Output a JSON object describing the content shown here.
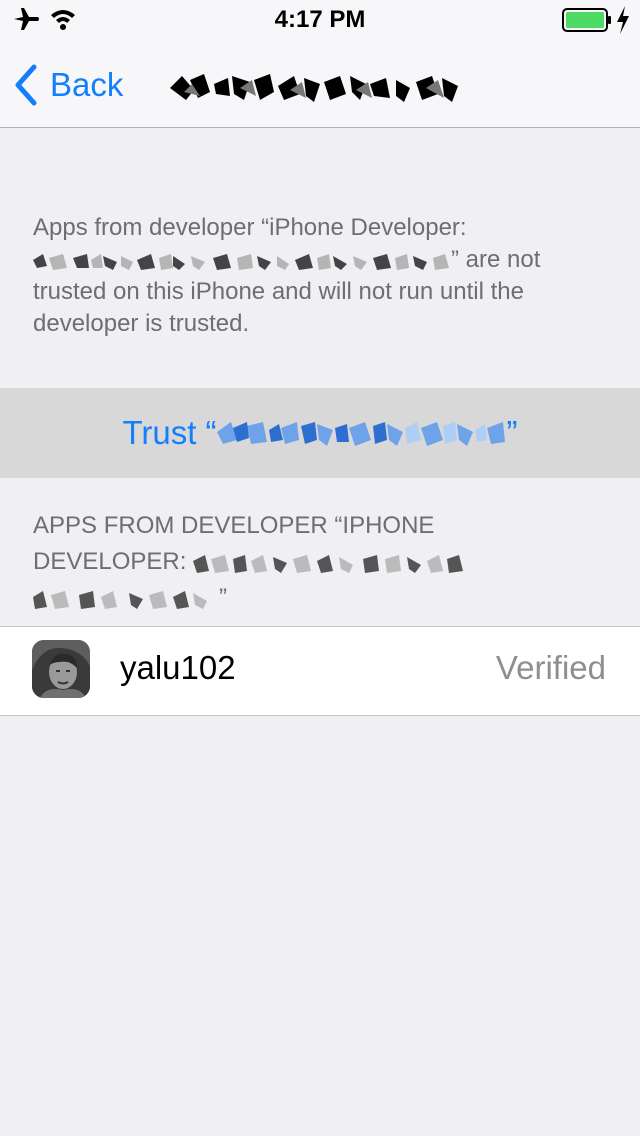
{
  "status_bar": {
    "time": "4:17 PM",
    "icons": [
      "airplane-icon",
      "wifi-icon",
      "battery-icon",
      "charging-bolt-icon"
    ],
    "battery_color": "#4cd964"
  },
  "nav": {
    "back_label": "Back",
    "title_redacted": true
  },
  "description": {
    "part1": "Apps from developer “iPhone Developer:",
    "part2": "” are not trusted on this iPhone and will not run until the developer is trusted."
  },
  "trust": {
    "label_prefix": "Trust “",
    "label_suffix": "”"
  },
  "section": {
    "header_line1": "APPS FROM DEVELOPER “IPHONE",
    "header_line2": "DEVELOPER:",
    "header_close": "”"
  },
  "app": {
    "name": "yalu102",
    "status": "Verified",
    "icon": "app-icon"
  },
  "colors": {
    "accent": "#157efb",
    "background": "#efeff4",
    "secondary_text": "#6d6d72",
    "status_text": "#8e8e93"
  }
}
